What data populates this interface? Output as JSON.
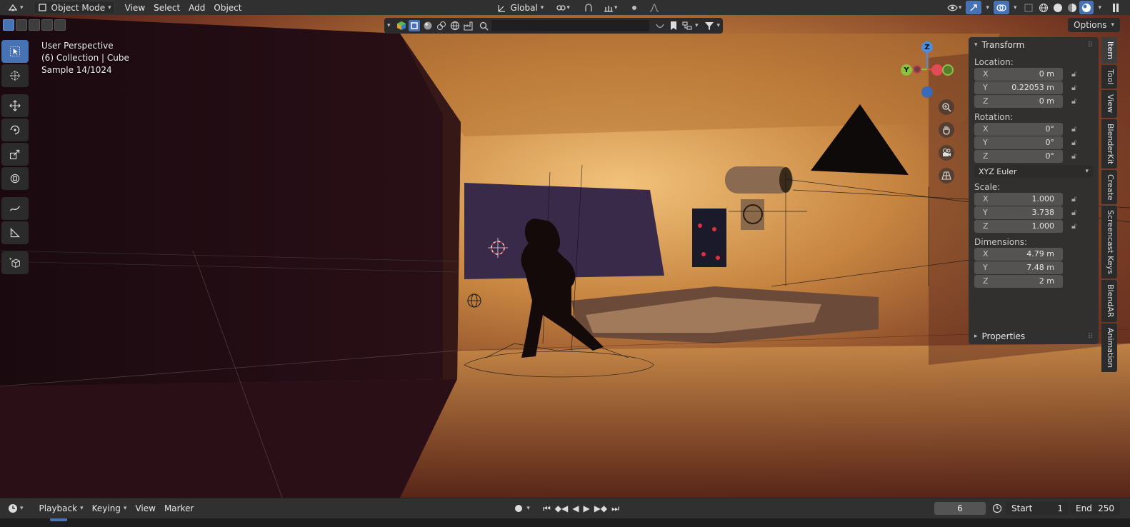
{
  "header": {
    "editor_type_icon": "3d-viewport-icon",
    "mode": "Object Mode",
    "menus": [
      "View",
      "Select",
      "Add",
      "Object"
    ],
    "transform_orientation": "Global",
    "pivot_icon": "pivot-point-icon",
    "snap_icon": "snap-icon",
    "proportional_icon": "proportional-editing-icon"
  },
  "viewport_header": {
    "search_placeholder": "",
    "options_label": "Options"
  },
  "viewport_info": {
    "line1": "User Perspective",
    "line2": "(6) Collection | Cube",
    "line3": "Sample 14/1024"
  },
  "toolbar": {
    "tools": [
      "select-box-icon",
      "cursor-icon",
      "move-icon",
      "rotate-icon",
      "scale-icon",
      "transform-icon",
      "annotate-icon",
      "measure-icon",
      "add-cube-icon"
    ]
  },
  "gizmo": {
    "z_label": "Z",
    "y_label": "Y",
    "colors": {
      "x": "#e04b55",
      "y": "#8bc13d",
      "z": "#4a8de0"
    }
  },
  "transform_panel": {
    "title": "Transform",
    "location_label": "Location:",
    "location": [
      {
        "axis": "X",
        "value": "0 m"
      },
      {
        "axis": "Y",
        "value": "0.22053 m"
      },
      {
        "axis": "Z",
        "value": "0 m"
      }
    ],
    "rotation_label": "Rotation:",
    "rotation": [
      {
        "axis": "X",
        "value": "0°"
      },
      {
        "axis": "Y",
        "value": "0°"
      },
      {
        "axis": "Z",
        "value": "0°"
      }
    ],
    "rotation_mode": "XYZ Euler",
    "scale_label": "Scale:",
    "scale": [
      {
        "axis": "X",
        "value": "1.000"
      },
      {
        "axis": "Y",
        "value": "3.738"
      },
      {
        "axis": "Z",
        "value": "1.000"
      }
    ],
    "dimensions_label": "Dimensions:",
    "dimensions": [
      {
        "axis": "X",
        "value": "4.79 m"
      },
      {
        "axis": "Y",
        "value": "7.48 m"
      },
      {
        "axis": "Z",
        "value": "2 m"
      }
    ]
  },
  "properties_panel": {
    "title": "Properties"
  },
  "side_tabs": [
    "Item",
    "Tool",
    "View",
    "BlenderKit",
    "Create",
    "Screencast Keys",
    "BlendAR",
    "Animation"
  ],
  "timeline": {
    "menus": [
      "Playback",
      "Keying",
      "View",
      "Marker"
    ],
    "current_frame": "6",
    "start_label": "Start",
    "start_value": "1",
    "end_label": "End",
    "end_value": "250"
  },
  "colors": {
    "accent": "#4772b3",
    "panel_bg": "#303030",
    "field_bg": "#545454"
  }
}
